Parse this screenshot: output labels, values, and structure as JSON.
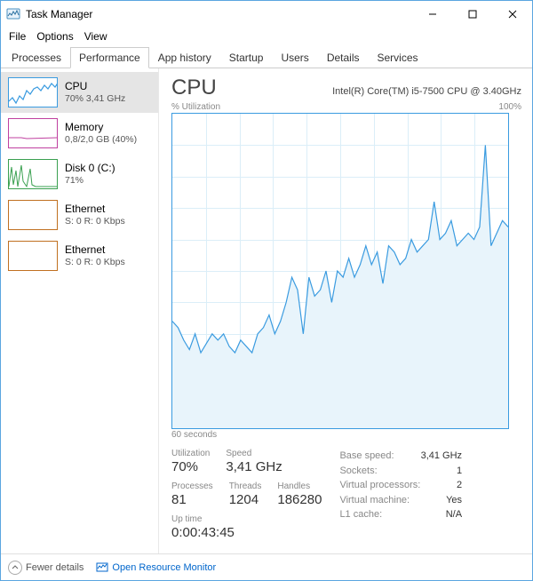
{
  "window": {
    "title": "Task Manager"
  },
  "menu": {
    "file": "File",
    "options": "Options",
    "view": "View"
  },
  "tabs": {
    "processes": "Processes",
    "performance": "Performance",
    "app_history": "App history",
    "startup": "Startup",
    "users": "Users",
    "details": "Details",
    "services": "Services"
  },
  "sidebar": {
    "items": [
      {
        "label": "CPU",
        "sub": "70% 3,41 GHz",
        "color": "#3a9be0"
      },
      {
        "label": "Memory",
        "sub": "0,8/2,0 GB (40%)",
        "color": "#c040a0"
      },
      {
        "label": "Disk 0 (C:)",
        "sub": "71%",
        "color": "#3aa050"
      },
      {
        "label": "Ethernet",
        "sub": "S: 0  R: 0 Kbps",
        "color": "#c07020"
      },
      {
        "label": "Ethernet",
        "sub": "S: 0  R: 0 Kbps",
        "color": "#c07020"
      }
    ]
  },
  "main": {
    "title": "CPU",
    "subtitle": "Intel(R) Core(TM) i5-7500 CPU @ 3.40GHz",
    "chart_top_left": "% Utilization",
    "chart_top_right": "100%",
    "chart_bottom_left": "60 seconds",
    "stats_left": {
      "utilization_label": "Utilization",
      "utilization": "70%",
      "speed_label": "Speed",
      "speed": "3,41 GHz",
      "processes_label": "Processes",
      "processes": "81",
      "threads_label": "Threads",
      "threads": "1204",
      "handles_label": "Handles",
      "handles": "186280",
      "uptime_label": "Up time",
      "uptime": "0:00:43:45"
    },
    "stats_right": {
      "base_speed_label": "Base speed:",
      "base_speed": "3,41 GHz",
      "sockets_label": "Sockets:",
      "sockets": "1",
      "vproc_label": "Virtual processors:",
      "vproc": "2",
      "vm_label": "Virtual machine:",
      "vm": "Yes",
      "l1_label": "L1 cache:",
      "l1": "N/A"
    }
  },
  "footer": {
    "fewer": "Fewer details",
    "monitor": "Open Resource Monitor"
  },
  "chart_data": {
    "type": "line",
    "title": "CPU % Utilization",
    "xlabel": "seconds",
    "ylabel": "% Utilization",
    "ylim": [
      0,
      100
    ],
    "x_range_seconds": 60,
    "values": [
      34,
      32,
      28,
      25,
      30,
      24,
      27,
      30,
      28,
      30,
      26,
      24,
      28,
      26,
      24,
      30,
      32,
      36,
      30,
      34,
      40,
      48,
      44,
      30,
      48,
      42,
      44,
      50,
      40,
      50,
      48,
      54,
      48,
      52,
      58,
      52,
      56,
      46,
      58,
      56,
      52,
      54,
      60,
      56,
      58,
      60,
      72,
      60,
      62,
      66,
      58,
      60,
      62,
      60,
      64,
      90,
      58,
      62,
      66,
      64
    ]
  }
}
